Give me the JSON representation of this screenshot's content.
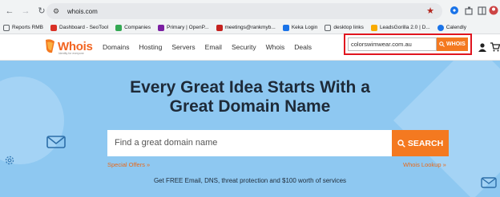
{
  "browser": {
    "url": "whois.com",
    "bookmarks": [
      {
        "label": "Reports RMB",
        "color": "#5f6368"
      },
      {
        "label": "Dashboard - SeoTool",
        "color": "#d93025"
      },
      {
        "label": "Companies",
        "color": "#34a853"
      },
      {
        "label": "Primary | OpenP...",
        "color": "#7b1fa2"
      },
      {
        "label": "meetings@rankmyb...",
        "color": "#c5221f"
      },
      {
        "label": "Keka Login",
        "color": "#1a73e8"
      },
      {
        "label": "desktop links",
        "color": "#5f6368"
      },
      {
        "label": "LeadsGorilla 2.0 | D...",
        "color": "#f9ab00"
      },
      {
        "label": "Calendly",
        "color": "#1a73e8"
      }
    ]
  },
  "header": {
    "logo_text": "Whois",
    "logo_tagline": "Identity for everyone",
    "nav": [
      "Domains",
      "Hosting",
      "Servers",
      "Email",
      "Security",
      "Whois",
      "Deals"
    ],
    "search_value": "colorswimwear.com.au",
    "search_button": "WHOIS"
  },
  "hero": {
    "headline_line1": "Every Great Idea Starts With a",
    "headline_line2": "Great Domain Name",
    "search_placeholder": "Find a great domain name",
    "search_button": "SEARCH",
    "special_offers": "Special Offers »",
    "whois_lookup": "Whois Lookup »",
    "free_text": "Get FREE Email, DNS, threat protection and $100 worth of services"
  },
  "colors": {
    "accent": "#f47920",
    "hero_bg": "#8ec8f1",
    "highlight_border": "#e0141e"
  }
}
